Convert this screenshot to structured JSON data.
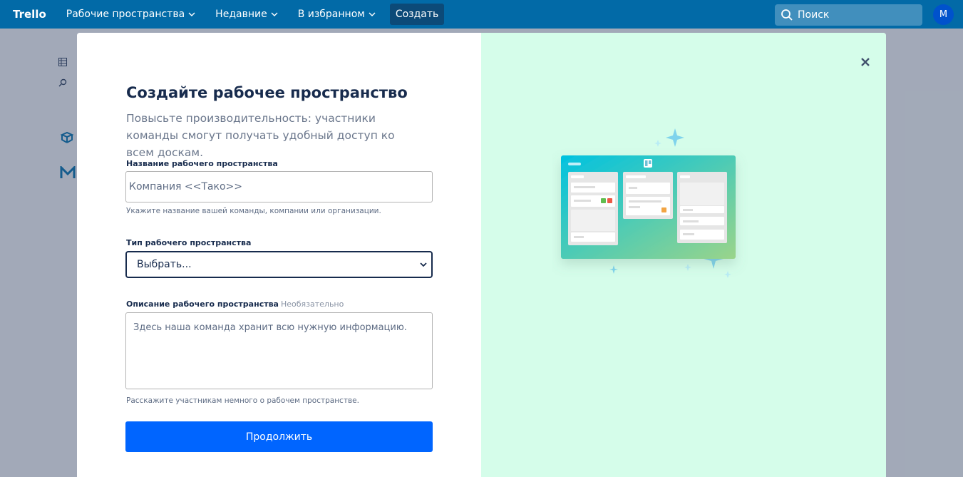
{
  "topbar": {
    "logo": "Trello",
    "nav": [
      {
        "label": "Рабочие пространства"
      },
      {
        "label": "Недавние"
      },
      {
        "label": "В избранном"
      }
    ],
    "create_label": "Создать",
    "search_placeholder": "Поиск",
    "avatar_initial": "M",
    "bar_color": "#026aa7"
  },
  "modal": {
    "title": "Создайте рабочее пространство",
    "subtitle": "Повысьте производительность: участники команды смогут получать удобный доступ ко всем доскам.",
    "name_field": {
      "label": "Название рабочего пространства",
      "value": "Компания <<Тако>>",
      "help": "Укажите название вашей команды, компании или организации."
    },
    "type_field": {
      "label": "Тип рабочего пространства",
      "selected": "Выбрать..."
    },
    "description_field": {
      "label": "Описание рабочего пространства",
      "optional": "Необязательно",
      "placeholder": "Здесь наша команда хранит всю нужную информацию.",
      "help": "Расскажите участникам немного о рабочем пространстве."
    },
    "continue_label": "Продолжить",
    "accent_color": "#0065ff",
    "illustration_bg": "#d5fdea"
  }
}
